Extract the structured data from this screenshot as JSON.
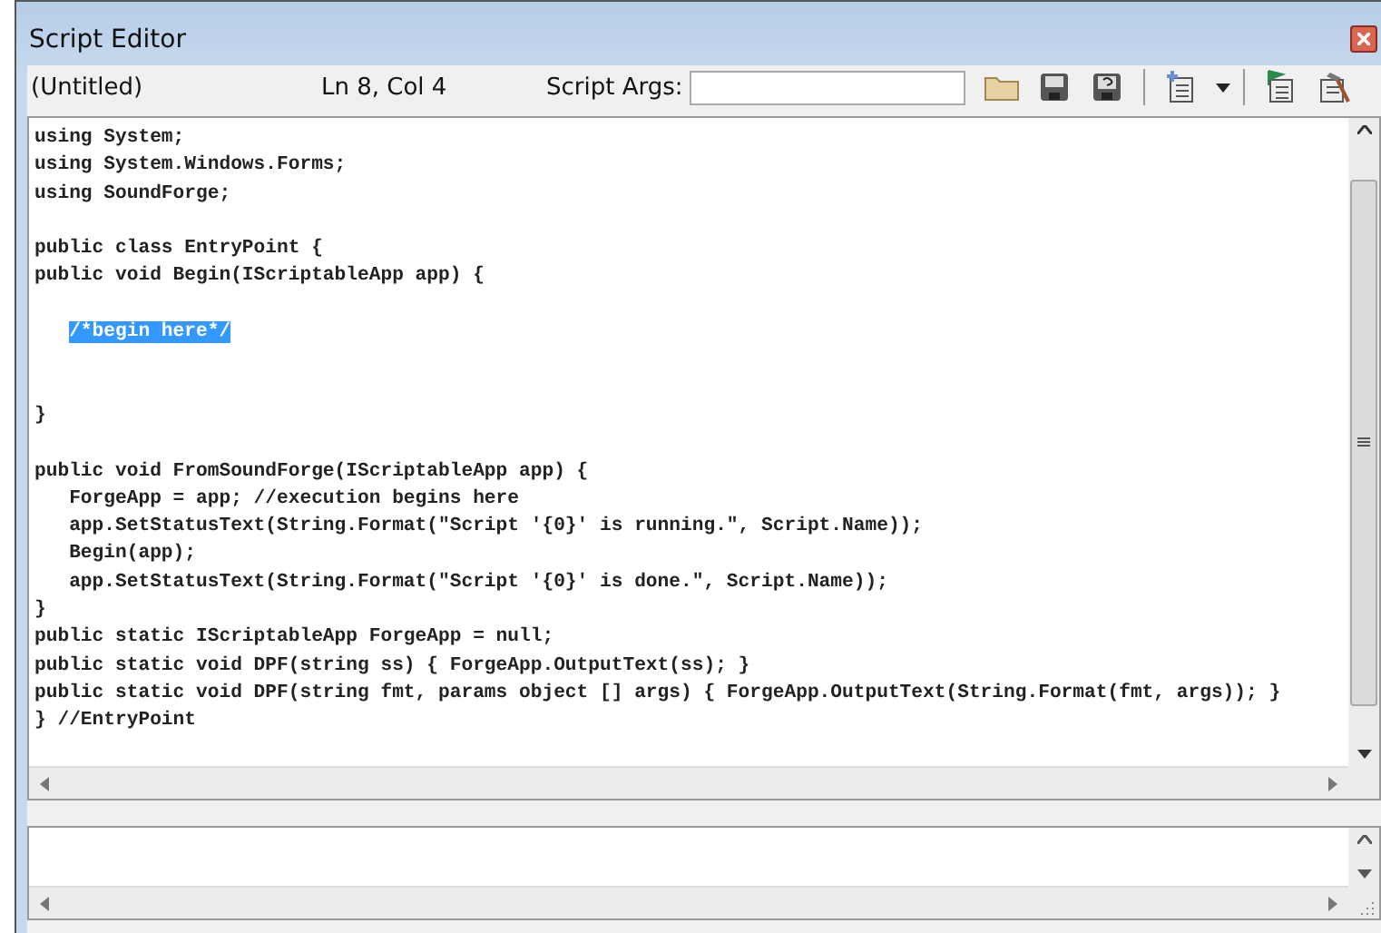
{
  "window": {
    "title": "Script Editor"
  },
  "toolbar": {
    "file_name": "(Untitled)",
    "position": "Ln 8, Col 4",
    "args_label": "Script Args:"
  },
  "code_lines": [
    {
      "text": "using System;"
    },
    {
      "text": "using System.Windows.Forms;"
    },
    {
      "text": "using SoundForge;"
    },
    {
      "kind": "blank"
    },
    {
      "text": "public class EntryPoint {"
    },
    {
      "text": "public void Begin(IScriptableApp app) {"
    },
    {
      "kind": "blank"
    },
    {
      "kind": "selection",
      "text": "/*begin here*/"
    },
    {
      "kind": "blank"
    },
    {
      "kind": "blank"
    },
    {
      "text": "}"
    },
    {
      "kind": "blank"
    },
    {
      "text": "public void FromSoundForge(IScriptableApp app) {"
    },
    {
      "text": "   ForgeApp = app; //execution begins here"
    },
    {
      "text": "   app.SetStatusText(String.Format(\"Script '{0}' is running.\", Script.Name));"
    },
    {
      "text": "   Begin(app);"
    },
    {
      "text": "   app.SetStatusText(String.Format(\"Script '{0}' is done.\", Script.Name));"
    },
    {
      "text": "}"
    },
    {
      "text": "public static IScriptableApp ForgeApp = null;"
    },
    {
      "text": "public static void DPF(string ss) { ForgeApp.OutputText(ss); }"
    },
    {
      "text": "public static void DPF(string fmt, params object [] args) { ForgeApp.OutputText(String.Format(fmt, args)); }"
    },
    {
      "text": "} //EntryPoint"
    }
  ]
}
